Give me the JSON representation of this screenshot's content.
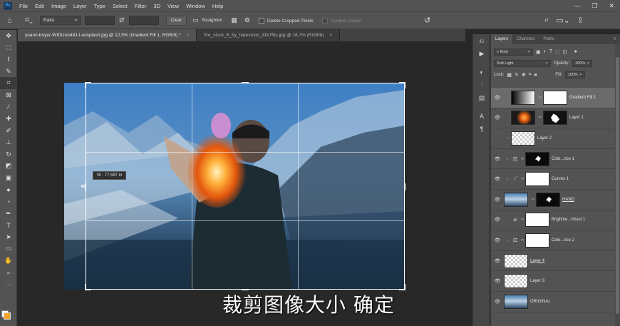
{
  "menubar": {
    "logo": "Ps",
    "items": [
      "File",
      "Edit",
      "Image",
      "Layer",
      "Type",
      "Select",
      "Filter",
      "3D",
      "View",
      "Window",
      "Help"
    ]
  },
  "options": {
    "ratio": "Ratio",
    "clear": "Clear",
    "straighten": "Straighten",
    "delete_cropped": "Delete Cropped Pixels",
    "content_aware": "Content-Aware"
  },
  "doc_tabs": [
    {
      "label": "yoann-boyer-WIDUoo49J-I-unsplash.jpg @ 12,5% (Gradient Fill 1, RGB/8) *",
      "active": true
    },
    {
      "label": "fire_stock_6_by_hatestock_d1k7f8s.jpg @ 16,7% (RGB/8)",
      "active": false
    }
  ],
  "canvas": {
    "size_tooltip": "W :   77,597 in",
    "subtitle": "裁剪图像大小  确定"
  },
  "panel": {
    "tabs": [
      "Layers",
      "Channels",
      "Paths"
    ],
    "kind": "Kind",
    "blend_mode": "Soft Light",
    "opacity_label": "Opacity:",
    "opacity": "100%",
    "lock_label": "Lock:",
    "fill_label": "Fill:",
    "fill": "100%"
  },
  "layers": [
    {
      "name": "Gradient Fill 1",
      "thumb": "grad",
      "mask": "white",
      "selected": true
    },
    {
      "name": "Layer 1",
      "thumb": "fire",
      "mask": "firemask"
    },
    {
      "name": "Layer 2",
      "thumb": "checker",
      "clip": true
    },
    {
      "name": "Colo...nce 1",
      "adj": "⚖",
      "mask": "black",
      "clip": true
    },
    {
      "name": "Curves 1",
      "adj": "⟋",
      "mask": "white",
      "clip": true
    },
    {
      "name": "HAND",
      "thumb": "photo",
      "mask": "black",
      "underline": true
    },
    {
      "name": "Brightne...ntrast 1",
      "adj": "☀",
      "mask": "white"
    },
    {
      "name": "Colo...nce 2",
      "adj": "⚖",
      "mask": "white",
      "clip": true
    },
    {
      "name": "Layer 4",
      "thumb": "checker",
      "underline": true
    },
    {
      "name": "Layer 3",
      "thumb": "checker"
    },
    {
      "name": "ORIGINAL",
      "thumb": "photo"
    }
  ],
  "colors": {
    "foreground": "#f3a629",
    "background": "#ffffff"
  }
}
